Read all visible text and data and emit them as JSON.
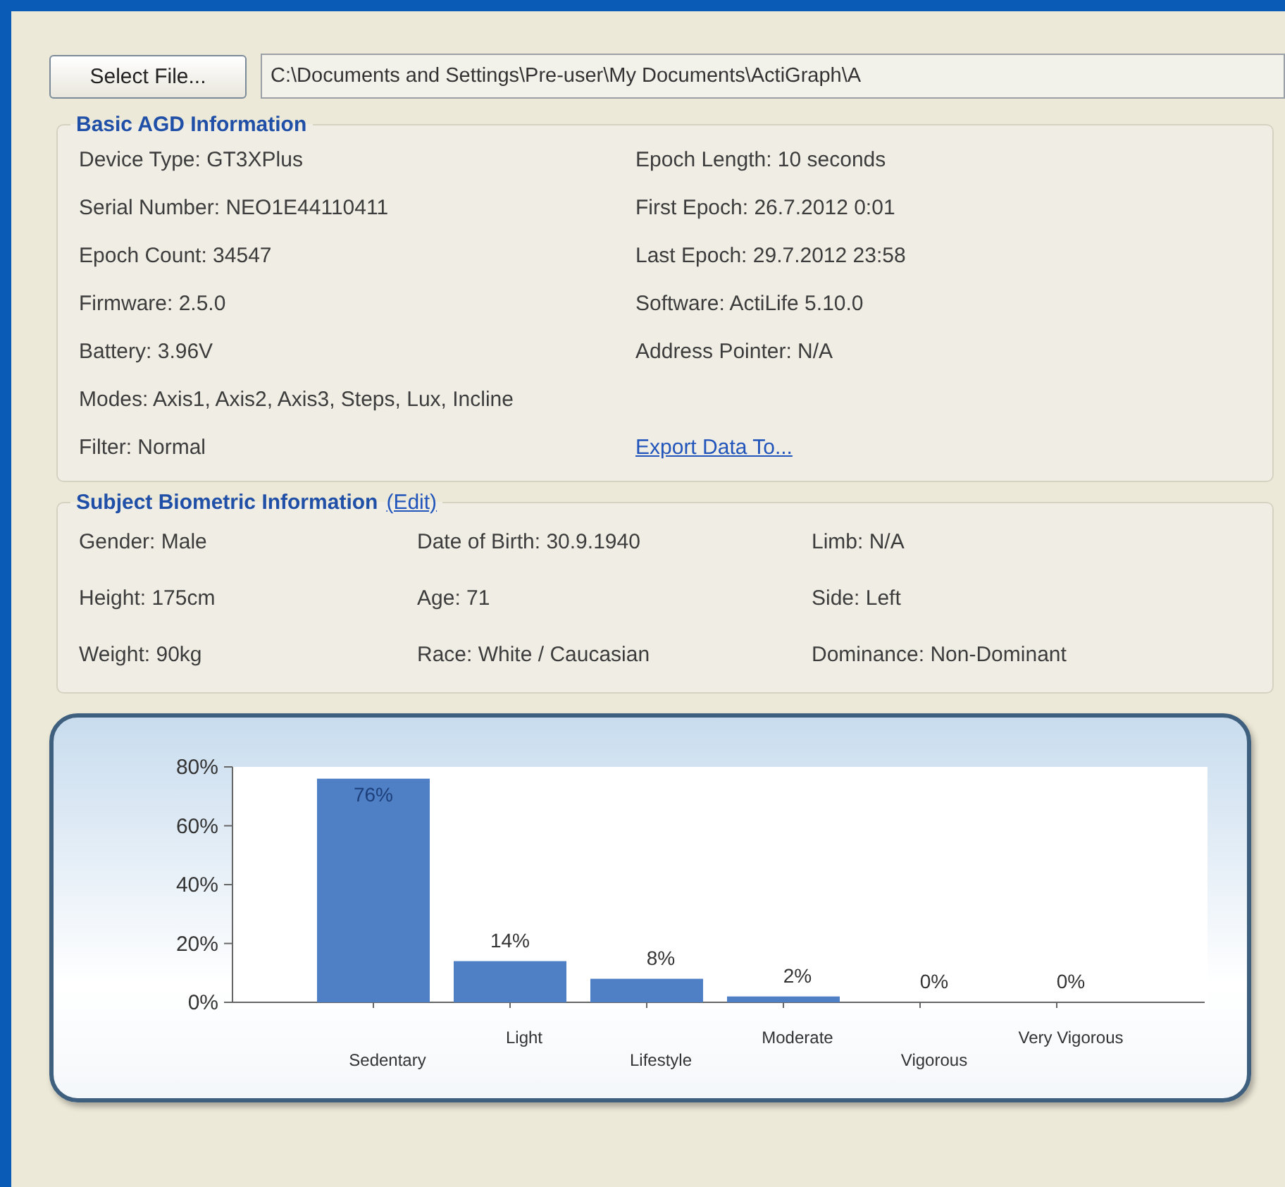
{
  "file": {
    "button": "Select File...",
    "path": "C:\\Documents and Settings\\Pre-user\\My Documents\\ActiGraph\\A"
  },
  "basic_info": {
    "title": "Basic AGD Information",
    "rows": [
      {
        "cells": [
          {
            "kind": "text",
            "text": "Device Type: GT3XPlus"
          },
          {
            "kind": "text",
            "text": "Epoch Length: 10 seconds"
          }
        ]
      },
      {
        "cells": [
          {
            "kind": "text",
            "text": "Serial Number: NEO1E44110411"
          },
          {
            "kind": "text",
            "text": "First Epoch: 26.7.2012 0:01"
          }
        ]
      },
      {
        "cells": [
          {
            "kind": "text",
            "text": "Epoch Count: 34547"
          },
          {
            "kind": "text",
            "text": "Last Epoch: 29.7.2012 23:58"
          }
        ]
      },
      {
        "cells": [
          {
            "kind": "text",
            "text": "Firmware: 2.5.0"
          },
          {
            "kind": "text",
            "text": "Software: ActiLife 5.10.0"
          }
        ]
      },
      {
        "cells": [
          {
            "kind": "text",
            "text": "Battery: 3.96V"
          },
          {
            "kind": "text",
            "text": "Address Pointer: N/A"
          }
        ]
      },
      {
        "cells": [
          {
            "kind": "text",
            "text": "Modes: Axis1, Axis2, Axis3, Steps, Lux, Incline"
          }
        ]
      },
      {
        "cells": [
          {
            "kind": "text",
            "text": "Filter: Normal"
          },
          {
            "kind": "link",
            "text": "Export Data To..."
          }
        ]
      }
    ]
  },
  "biometric_info": {
    "title": "Subject Biometric Information",
    "edit_link": "(Edit)",
    "rows": [
      {
        "cells": [
          {
            "kind": "text",
            "text": "Gender: Male"
          },
          {
            "kind": "text",
            "text": "Date of Birth: 30.9.1940"
          },
          {
            "kind": "text",
            "text": "Limb: N/A"
          }
        ]
      },
      {
        "cells": [
          {
            "kind": "text",
            "text": "Height: 175cm"
          },
          {
            "kind": "text",
            "text": "Age: 71"
          },
          {
            "kind": "text",
            "text": "Side: Left"
          }
        ]
      },
      {
        "cells": [
          {
            "kind": "text",
            "text": "Weight: 90kg"
          },
          {
            "kind": "text",
            "text": "Race: White / Caucasian"
          },
          {
            "kind": "text",
            "text": "Dominance: Non-Dominant"
          }
        ]
      }
    ]
  },
  "activity_chart": {
    "chart_data": {
      "type": "bar",
      "categories": [
        "Sedentary",
        "Light",
        "Lifestyle",
        "Moderate",
        "Vigorous",
        "Very Vigorous"
      ],
      "series": [
        {
          "color": "#4f7fc4",
          "values": [
            76,
            14,
            8,
            2,
            0,
            0
          ]
        }
      ],
      "ylim": [
        0,
        80
      ],
      "yticks": [
        {
          "value": 0,
          "label": "0%"
        },
        {
          "value": 20,
          "label": "20%"
        },
        {
          "value": 40,
          "label": "40%"
        },
        {
          "value": 60,
          "label": "60%"
        },
        {
          "value": 80,
          "label": "80%"
        }
      ],
      "value_labels": [
        "76%",
        "14%",
        "8%",
        "2%",
        "0%",
        "0%"
      ]
    }
  }
}
